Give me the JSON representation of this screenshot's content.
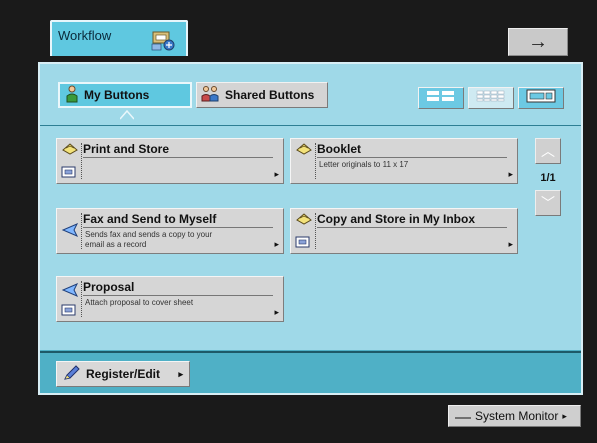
{
  "header": {
    "workflow_label": "Workflow",
    "arrow_symbol": "→"
  },
  "tabs": {
    "my_buttons": "My Buttons",
    "shared_buttons": "Shared Buttons"
  },
  "cards": [
    {
      "title": "Print and Store",
      "desc": ""
    },
    {
      "title": "Booklet",
      "desc": "Letter originals to 11 x 17"
    },
    {
      "title": "Fax and Send to Myself",
      "desc": "Sends fax and sends a copy to your\nemail as a record"
    },
    {
      "title": "Copy and Store in My Inbox",
      "desc": ""
    },
    {
      "title": "Proposal",
      "desc": "Attach proposal to cover sheet"
    }
  ],
  "pagination": {
    "indicator": "1/1"
  },
  "footer": {
    "register_label": "Register/Edit",
    "system_monitor_label": "System Monitor"
  },
  "colors": {
    "accent": "#4fb0c6",
    "panel_light": "#9fd9e8",
    "tab_active": "#5fc8e0"
  }
}
